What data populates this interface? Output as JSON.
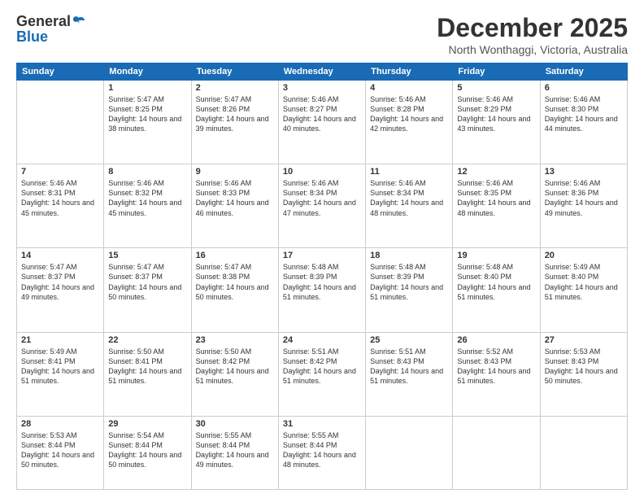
{
  "logo": {
    "general": "General",
    "blue": "Blue"
  },
  "header": {
    "month": "December 2025",
    "location": "North Wonthaggi, Victoria, Australia"
  },
  "weekdays": [
    "Sunday",
    "Monday",
    "Tuesday",
    "Wednesday",
    "Thursday",
    "Friday",
    "Saturday"
  ],
  "weeks": [
    [
      {
        "day": "",
        "sunrise": "",
        "sunset": "",
        "daylight": ""
      },
      {
        "day": "1",
        "sunrise": "Sunrise: 5:47 AM",
        "sunset": "Sunset: 8:25 PM",
        "daylight": "Daylight: 14 hours and 38 minutes."
      },
      {
        "day": "2",
        "sunrise": "Sunrise: 5:47 AM",
        "sunset": "Sunset: 8:26 PM",
        "daylight": "Daylight: 14 hours and 39 minutes."
      },
      {
        "day": "3",
        "sunrise": "Sunrise: 5:46 AM",
        "sunset": "Sunset: 8:27 PM",
        "daylight": "Daylight: 14 hours and 40 minutes."
      },
      {
        "day": "4",
        "sunrise": "Sunrise: 5:46 AM",
        "sunset": "Sunset: 8:28 PM",
        "daylight": "Daylight: 14 hours and 42 minutes."
      },
      {
        "day": "5",
        "sunrise": "Sunrise: 5:46 AM",
        "sunset": "Sunset: 8:29 PM",
        "daylight": "Daylight: 14 hours and 43 minutes."
      },
      {
        "day": "6",
        "sunrise": "Sunrise: 5:46 AM",
        "sunset": "Sunset: 8:30 PM",
        "daylight": "Daylight: 14 hours and 44 minutes."
      }
    ],
    [
      {
        "day": "7",
        "sunrise": "Sunrise: 5:46 AM",
        "sunset": "Sunset: 8:31 PM",
        "daylight": "Daylight: 14 hours and 45 minutes."
      },
      {
        "day": "8",
        "sunrise": "Sunrise: 5:46 AM",
        "sunset": "Sunset: 8:32 PM",
        "daylight": "Daylight: 14 hours and 45 minutes."
      },
      {
        "day": "9",
        "sunrise": "Sunrise: 5:46 AM",
        "sunset": "Sunset: 8:33 PM",
        "daylight": "Daylight: 14 hours and 46 minutes."
      },
      {
        "day": "10",
        "sunrise": "Sunrise: 5:46 AM",
        "sunset": "Sunset: 8:34 PM",
        "daylight": "Daylight: 14 hours and 47 minutes."
      },
      {
        "day": "11",
        "sunrise": "Sunrise: 5:46 AM",
        "sunset": "Sunset: 8:34 PM",
        "daylight": "Daylight: 14 hours and 48 minutes."
      },
      {
        "day": "12",
        "sunrise": "Sunrise: 5:46 AM",
        "sunset": "Sunset: 8:35 PM",
        "daylight": "Daylight: 14 hours and 48 minutes."
      },
      {
        "day": "13",
        "sunrise": "Sunrise: 5:46 AM",
        "sunset": "Sunset: 8:36 PM",
        "daylight": "Daylight: 14 hours and 49 minutes."
      }
    ],
    [
      {
        "day": "14",
        "sunrise": "Sunrise: 5:47 AM",
        "sunset": "Sunset: 8:37 PM",
        "daylight": "Daylight: 14 hours and 49 minutes."
      },
      {
        "day": "15",
        "sunrise": "Sunrise: 5:47 AM",
        "sunset": "Sunset: 8:37 PM",
        "daylight": "Daylight: 14 hours and 50 minutes."
      },
      {
        "day": "16",
        "sunrise": "Sunrise: 5:47 AM",
        "sunset": "Sunset: 8:38 PM",
        "daylight": "Daylight: 14 hours and 50 minutes."
      },
      {
        "day": "17",
        "sunrise": "Sunrise: 5:48 AM",
        "sunset": "Sunset: 8:39 PM",
        "daylight": "Daylight: 14 hours and 51 minutes."
      },
      {
        "day": "18",
        "sunrise": "Sunrise: 5:48 AM",
        "sunset": "Sunset: 8:39 PM",
        "daylight": "Daylight: 14 hours and 51 minutes."
      },
      {
        "day": "19",
        "sunrise": "Sunrise: 5:48 AM",
        "sunset": "Sunset: 8:40 PM",
        "daylight": "Daylight: 14 hours and 51 minutes."
      },
      {
        "day": "20",
        "sunrise": "Sunrise: 5:49 AM",
        "sunset": "Sunset: 8:40 PM",
        "daylight": "Daylight: 14 hours and 51 minutes."
      }
    ],
    [
      {
        "day": "21",
        "sunrise": "Sunrise: 5:49 AM",
        "sunset": "Sunset: 8:41 PM",
        "daylight": "Daylight: 14 hours and 51 minutes."
      },
      {
        "day": "22",
        "sunrise": "Sunrise: 5:50 AM",
        "sunset": "Sunset: 8:41 PM",
        "daylight": "Daylight: 14 hours and 51 minutes."
      },
      {
        "day": "23",
        "sunrise": "Sunrise: 5:50 AM",
        "sunset": "Sunset: 8:42 PM",
        "daylight": "Daylight: 14 hours and 51 minutes."
      },
      {
        "day": "24",
        "sunrise": "Sunrise: 5:51 AM",
        "sunset": "Sunset: 8:42 PM",
        "daylight": "Daylight: 14 hours and 51 minutes."
      },
      {
        "day": "25",
        "sunrise": "Sunrise: 5:51 AM",
        "sunset": "Sunset: 8:43 PM",
        "daylight": "Daylight: 14 hours and 51 minutes."
      },
      {
        "day": "26",
        "sunrise": "Sunrise: 5:52 AM",
        "sunset": "Sunset: 8:43 PM",
        "daylight": "Daylight: 14 hours and 51 minutes."
      },
      {
        "day": "27",
        "sunrise": "Sunrise: 5:53 AM",
        "sunset": "Sunset: 8:43 PM",
        "daylight": "Daylight: 14 hours and 50 minutes."
      }
    ],
    [
      {
        "day": "28",
        "sunrise": "Sunrise: 5:53 AM",
        "sunset": "Sunset: 8:44 PM",
        "daylight": "Daylight: 14 hours and 50 minutes."
      },
      {
        "day": "29",
        "sunrise": "Sunrise: 5:54 AM",
        "sunset": "Sunset: 8:44 PM",
        "daylight": "Daylight: 14 hours and 50 minutes."
      },
      {
        "day": "30",
        "sunrise": "Sunrise: 5:55 AM",
        "sunset": "Sunset: 8:44 PM",
        "daylight": "Daylight: 14 hours and 49 minutes."
      },
      {
        "day": "31",
        "sunrise": "Sunrise: 5:55 AM",
        "sunset": "Sunset: 8:44 PM",
        "daylight": "Daylight: 14 hours and 48 minutes."
      },
      {
        "day": "",
        "sunrise": "",
        "sunset": "",
        "daylight": ""
      },
      {
        "day": "",
        "sunrise": "",
        "sunset": "",
        "daylight": ""
      },
      {
        "day": "",
        "sunrise": "",
        "sunset": "",
        "daylight": ""
      }
    ]
  ]
}
